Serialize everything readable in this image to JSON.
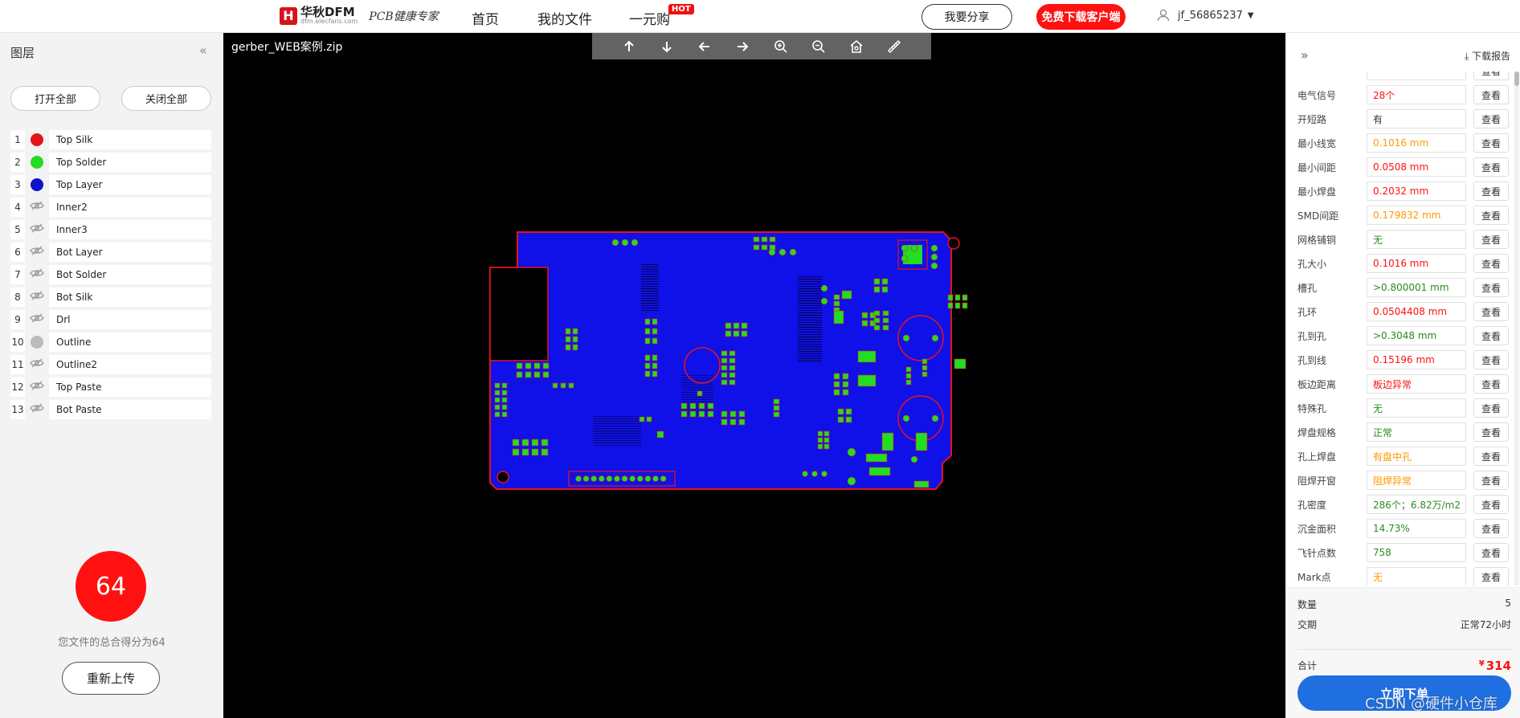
{
  "header": {
    "logo_mark": "H",
    "brand_name": "华秋DFM",
    "brand_domain": "dfm.elecfans.com",
    "slogan": "PCB健康专家",
    "nav": [
      "首页",
      "我的文件",
      "一元购"
    ],
    "hot_badge": "HOT",
    "share_label": "我要分享",
    "download_client_label": "免费下载客户端",
    "username": "jf_56865237"
  },
  "left_panel": {
    "title": "图层",
    "open_all": "打开全部",
    "close_all": "关闭全部",
    "layers": [
      {
        "num": "1",
        "name": "Top Silk",
        "color": "#e3141b",
        "visible": true
      },
      {
        "num": "2",
        "name": "Top Solder",
        "color": "#22dd22",
        "visible": true
      },
      {
        "num": "3",
        "name": "Top Layer",
        "color": "#1111cc",
        "visible": true
      },
      {
        "num": "4",
        "name": "Inner2",
        "visible": false
      },
      {
        "num": "5",
        "name": "Inner3",
        "visible": false
      },
      {
        "num": "6",
        "name": "Bot Layer",
        "visible": false
      },
      {
        "num": "7",
        "name": "Bot Solder",
        "visible": false
      },
      {
        "num": "8",
        "name": "Bot Silk",
        "visible": false
      },
      {
        "num": "9",
        "name": "Drl",
        "visible": false
      },
      {
        "num": "10",
        "name": "Outline",
        "color": "#bbbbbb",
        "visible": true
      },
      {
        "num": "11",
        "name": "Outline2",
        "visible": false
      },
      {
        "num": "12",
        "name": "Top Paste",
        "visible": false
      },
      {
        "num": "13",
        "name": "Bot Paste",
        "visible": false
      }
    ],
    "score": "64",
    "score_text": "您文件的总合得分为64",
    "reupload": "重新上传"
  },
  "viewer": {
    "filename": "gerber_WEB案例.zip",
    "tools": [
      "arrow-up-icon",
      "arrow-down-icon",
      "arrow-left-icon",
      "arrow-right-icon",
      "zoom-in-icon",
      "zoom-out-icon",
      "home-icon",
      "ruler-icon"
    ],
    "pcb_colors": {
      "board": "#1010e8",
      "outline": "#e3141b",
      "pads": "#22dd22",
      "silk": "#e3141b"
    }
  },
  "right_panel": {
    "download_report": "下载报告",
    "view_label": "查看",
    "checks": [
      {
        "label": "",
        "value": "",
        "tone": "c-dark"
      },
      {
        "label": "电气信号",
        "value": "28个",
        "tone": "c-red"
      },
      {
        "label": "开短路",
        "value": "有",
        "tone": "c-dark"
      },
      {
        "label": "最小线宽",
        "value": "0.1016 mm",
        "tone": "c-orange"
      },
      {
        "label": "最小间距",
        "value": "0.0508 mm",
        "tone": "c-red"
      },
      {
        "label": "最小焊盘",
        "value": "0.2032 mm",
        "tone": "c-red"
      },
      {
        "label": "SMD间距",
        "value": "0.179832 mm",
        "tone": "c-orange"
      },
      {
        "label": "网格铺铜",
        "value": "无",
        "tone": "c-green"
      },
      {
        "label": "孔大小",
        "value": "0.1016 mm",
        "tone": "c-red"
      },
      {
        "label": "槽孔",
        "value": ">0.800001 mm",
        "tone": "c-green"
      },
      {
        "label": "孔环",
        "value": "0.0504408 mm",
        "tone": "c-red"
      },
      {
        "label": "孔到孔",
        "value": ">0.3048 mm",
        "tone": "c-green"
      },
      {
        "label": "孔到线",
        "value": "0.15196 mm",
        "tone": "c-red"
      },
      {
        "label": "板边距离",
        "value": "板边异常",
        "tone": "c-red"
      },
      {
        "label": "特殊孔",
        "value": "无",
        "tone": "c-green"
      },
      {
        "label": "焊盘规格",
        "value": "正常",
        "tone": "c-green"
      },
      {
        "label": "孔上焊盘",
        "value": "有盘中孔",
        "tone": "c-orange"
      },
      {
        "label": "阻焊开窗",
        "value": "阻焊异常",
        "tone": "c-orange"
      },
      {
        "label": "孔密度",
        "value": "286个；6.82万/m2",
        "tone": "c-green"
      },
      {
        "label": "沉金面积",
        "value": "14.73%",
        "tone": "c-green"
      },
      {
        "label": "飞针点数",
        "value": "758",
        "tone": "c-green"
      },
      {
        "label": "Mark点",
        "value": "无",
        "tone": "c-orange"
      }
    ],
    "summary": {
      "qty_label": "数量",
      "qty_value": "5",
      "lead_label": "交期",
      "lead_value": "正常72小时",
      "total_label": "合计",
      "currency": "¥",
      "total_value": "314",
      "order_label": "立即下单"
    }
  },
  "watermark": "CSDN @硬件小仓库"
}
